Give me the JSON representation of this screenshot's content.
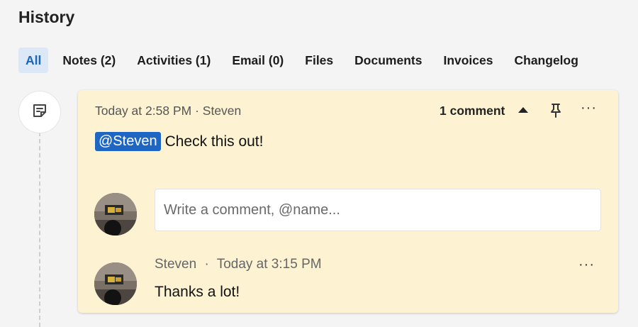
{
  "page": {
    "title": "History"
  },
  "tabs": [
    {
      "label": "All",
      "active": true
    },
    {
      "label": "Notes (2)"
    },
    {
      "label": "Activities (1)"
    },
    {
      "label": "Email (0)"
    },
    {
      "label": "Files"
    },
    {
      "label": "Documents"
    },
    {
      "label": "Invoices"
    },
    {
      "label": "Changelog"
    }
  ],
  "timeline": {
    "icon": "note-icon"
  },
  "note": {
    "timestamp": "Today at 2:58 PM",
    "author": "Steven",
    "separator": "·",
    "comment_count": "1 comment",
    "mention": "@Steven",
    "text": "Check this out!",
    "comment_placeholder": "Write a comment, @name...",
    "more_label": "···"
  },
  "reply": {
    "author": "Steven",
    "separator": "·",
    "timestamp": "Today at 3:15 PM",
    "text": "Thanks a lot!",
    "more_label": "···"
  },
  "colors": {
    "card_background": "#fdf3d2",
    "mention_background": "#1f66c2",
    "active_tab_background": "#dce8f5",
    "active_tab_text": "#1a66b8"
  }
}
